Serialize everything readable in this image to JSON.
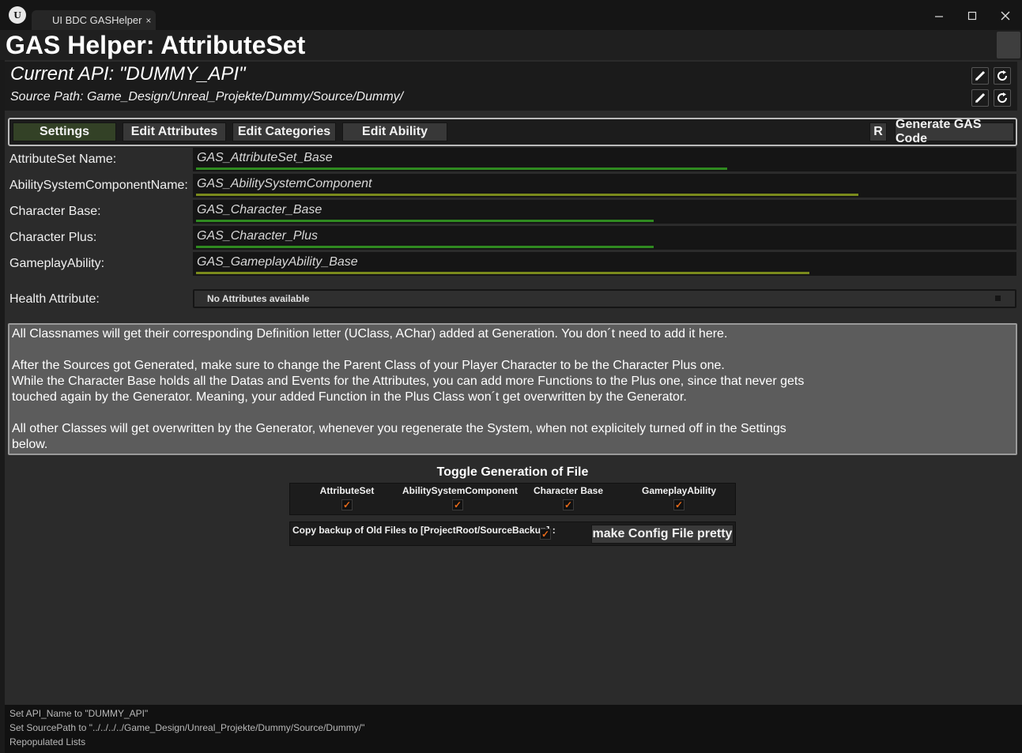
{
  "window": {
    "tab_title": "UI BDC GASHelper",
    "tab_close": "×",
    "logo_text": "U",
    "minimize_icon": "minimize-icon",
    "maximize_icon": "maximize-icon",
    "close_icon": "close-icon"
  },
  "page_title": "GAS Helper: AttributeSet",
  "api": {
    "current_api": "Current API: \"DUMMY_API\"",
    "source_path": "Source Path: Game_Design/Unreal_Projekte/Dummy/Source/Dummy/"
  },
  "toolbar": {
    "tabs": [
      "Settings",
      "Edit Attributes",
      "Edit Categories",
      "Edit Ability"
    ],
    "active_tab": "Settings",
    "r_label": "R",
    "generate_label": "Generate GAS Code"
  },
  "settings": {
    "rows": [
      {
        "label": "AttributeSet Name:",
        "value": "GAS_AttributeSet_Base",
        "bar_fill": 0.65,
        "bar_color": "#2f8a20"
      },
      {
        "label": "AbilitySystemComponentName:",
        "value": "GAS_AbilitySystemComponent",
        "bar_fill": 0.81,
        "bar_color": "#7a8a1c"
      },
      {
        "label": "Character Base:",
        "value": "GAS_Character_Base",
        "bar_fill": 0.56,
        "bar_color": "#2f8a20"
      },
      {
        "label": "Character Plus:",
        "value": "GAS_Character_Plus",
        "bar_fill": 0.56,
        "bar_color": "#2f8a20"
      },
      {
        "label": "GameplayAbility:",
        "value": "GAS_GameplayAbility_Base",
        "bar_fill": 0.75,
        "bar_color": "#7a8a1c"
      }
    ],
    "health_label": "Health Attribute:",
    "health_value": "No Attributes available"
  },
  "info": {
    "p1": "All Classnames will get their corresponding Definition letter (UClass, AChar) added at Generation. You don´t need to add it here.",
    "p2a": "After the Sources got Generated, make sure to change the Parent Class of your Player Character to be the Character Plus one.",
    "p2b": "While the Character Base holds all the Datas and Events for the Attributes, you can add more Functions to the Plus one, since that never gets",
    "p2c": "touched again by the Generator. Meaning, your added Function in the Plus Class won´t get overwritten by the Generator.",
    "p3a": "All other Classes will get overwritten by the Generator, whenever you regenerate the System, when not explicitely turned off in the Settings",
    "p3b": "below."
  },
  "toggle": {
    "title": "Toggle Generation of File",
    "items": [
      {
        "label": "AttributeSet",
        "checked": true
      },
      {
        "label": "AbilitySystemComponent",
        "checked": true
      },
      {
        "label": "Character Base",
        "checked": true
      },
      {
        "label": "GameplayAbility",
        "checked": true
      }
    ],
    "check_mark": "✓",
    "backup_label": "Copy backup of Old Files to [ProjectRoot/SourceBackup] :",
    "backup_checked": true,
    "pretty_label": "make Config File pretty"
  },
  "log": [
    "Set API_Name to \"DUMMY_API\"",
    "Set SourcePath to \"../../../../Game_Design/Unreal_Projekte/Dummy/Source/Dummy/\"",
    "Repopulated Lists"
  ],
  "colors": {
    "accent_check": "#e86a1a",
    "active_tab": "#334126"
  }
}
